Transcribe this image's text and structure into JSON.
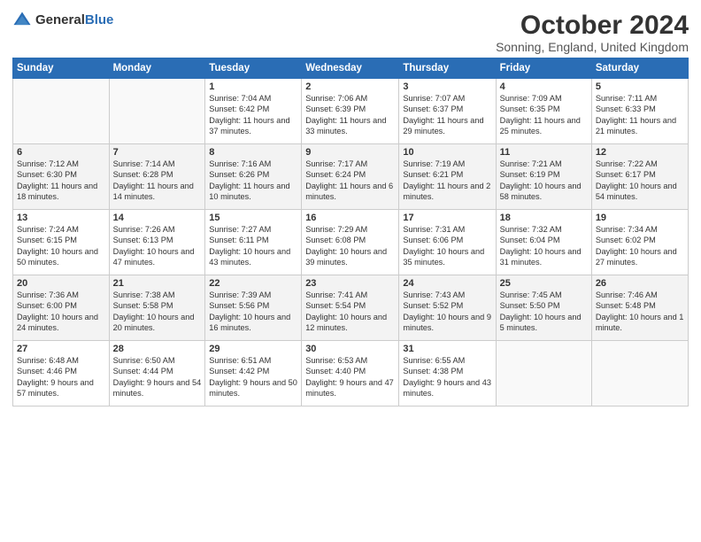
{
  "logo": {
    "text_general": "General",
    "text_blue": "Blue"
  },
  "title": "October 2024",
  "subtitle": "Sonning, England, United Kingdom",
  "weekdays": [
    "Sunday",
    "Monday",
    "Tuesday",
    "Wednesday",
    "Thursday",
    "Friday",
    "Saturday"
  ],
  "weeks": [
    [
      {
        "day": "",
        "info": ""
      },
      {
        "day": "",
        "info": ""
      },
      {
        "day": "1",
        "info": "Sunrise: 7:04 AM\nSunset: 6:42 PM\nDaylight: 11 hours\nand 37 minutes."
      },
      {
        "day": "2",
        "info": "Sunrise: 7:06 AM\nSunset: 6:39 PM\nDaylight: 11 hours\nand 33 minutes."
      },
      {
        "day": "3",
        "info": "Sunrise: 7:07 AM\nSunset: 6:37 PM\nDaylight: 11 hours\nand 29 minutes."
      },
      {
        "day": "4",
        "info": "Sunrise: 7:09 AM\nSunset: 6:35 PM\nDaylight: 11 hours\nand 25 minutes."
      },
      {
        "day": "5",
        "info": "Sunrise: 7:11 AM\nSunset: 6:33 PM\nDaylight: 11 hours\nand 21 minutes."
      }
    ],
    [
      {
        "day": "6",
        "info": "Sunrise: 7:12 AM\nSunset: 6:30 PM\nDaylight: 11 hours\nand 18 minutes."
      },
      {
        "day": "7",
        "info": "Sunrise: 7:14 AM\nSunset: 6:28 PM\nDaylight: 11 hours\nand 14 minutes."
      },
      {
        "day": "8",
        "info": "Sunrise: 7:16 AM\nSunset: 6:26 PM\nDaylight: 11 hours\nand 10 minutes."
      },
      {
        "day": "9",
        "info": "Sunrise: 7:17 AM\nSunset: 6:24 PM\nDaylight: 11 hours\nand 6 minutes."
      },
      {
        "day": "10",
        "info": "Sunrise: 7:19 AM\nSunset: 6:21 PM\nDaylight: 11 hours\nand 2 minutes."
      },
      {
        "day": "11",
        "info": "Sunrise: 7:21 AM\nSunset: 6:19 PM\nDaylight: 10 hours\nand 58 minutes."
      },
      {
        "day": "12",
        "info": "Sunrise: 7:22 AM\nSunset: 6:17 PM\nDaylight: 10 hours\nand 54 minutes."
      }
    ],
    [
      {
        "day": "13",
        "info": "Sunrise: 7:24 AM\nSunset: 6:15 PM\nDaylight: 10 hours\nand 50 minutes."
      },
      {
        "day": "14",
        "info": "Sunrise: 7:26 AM\nSunset: 6:13 PM\nDaylight: 10 hours\nand 47 minutes."
      },
      {
        "day": "15",
        "info": "Sunrise: 7:27 AM\nSunset: 6:11 PM\nDaylight: 10 hours\nand 43 minutes."
      },
      {
        "day": "16",
        "info": "Sunrise: 7:29 AM\nSunset: 6:08 PM\nDaylight: 10 hours\nand 39 minutes."
      },
      {
        "day": "17",
        "info": "Sunrise: 7:31 AM\nSunset: 6:06 PM\nDaylight: 10 hours\nand 35 minutes."
      },
      {
        "day": "18",
        "info": "Sunrise: 7:32 AM\nSunset: 6:04 PM\nDaylight: 10 hours\nand 31 minutes."
      },
      {
        "day": "19",
        "info": "Sunrise: 7:34 AM\nSunset: 6:02 PM\nDaylight: 10 hours\nand 27 minutes."
      }
    ],
    [
      {
        "day": "20",
        "info": "Sunrise: 7:36 AM\nSunset: 6:00 PM\nDaylight: 10 hours\nand 24 minutes."
      },
      {
        "day": "21",
        "info": "Sunrise: 7:38 AM\nSunset: 5:58 PM\nDaylight: 10 hours\nand 20 minutes."
      },
      {
        "day": "22",
        "info": "Sunrise: 7:39 AM\nSunset: 5:56 PM\nDaylight: 10 hours\nand 16 minutes."
      },
      {
        "day": "23",
        "info": "Sunrise: 7:41 AM\nSunset: 5:54 PM\nDaylight: 10 hours\nand 12 minutes."
      },
      {
        "day": "24",
        "info": "Sunrise: 7:43 AM\nSunset: 5:52 PM\nDaylight: 10 hours\nand 9 minutes."
      },
      {
        "day": "25",
        "info": "Sunrise: 7:45 AM\nSunset: 5:50 PM\nDaylight: 10 hours\nand 5 minutes."
      },
      {
        "day": "26",
        "info": "Sunrise: 7:46 AM\nSunset: 5:48 PM\nDaylight: 10 hours\nand 1 minute."
      }
    ],
    [
      {
        "day": "27",
        "info": "Sunrise: 6:48 AM\nSunset: 4:46 PM\nDaylight: 9 hours\nand 57 minutes."
      },
      {
        "day": "28",
        "info": "Sunrise: 6:50 AM\nSunset: 4:44 PM\nDaylight: 9 hours\nand 54 minutes."
      },
      {
        "day": "29",
        "info": "Sunrise: 6:51 AM\nSunset: 4:42 PM\nDaylight: 9 hours\nand 50 minutes."
      },
      {
        "day": "30",
        "info": "Sunrise: 6:53 AM\nSunset: 4:40 PM\nDaylight: 9 hours\nand 47 minutes."
      },
      {
        "day": "31",
        "info": "Sunrise: 6:55 AM\nSunset: 4:38 PM\nDaylight: 9 hours\nand 43 minutes."
      },
      {
        "day": "",
        "info": ""
      },
      {
        "day": "",
        "info": ""
      }
    ]
  ]
}
